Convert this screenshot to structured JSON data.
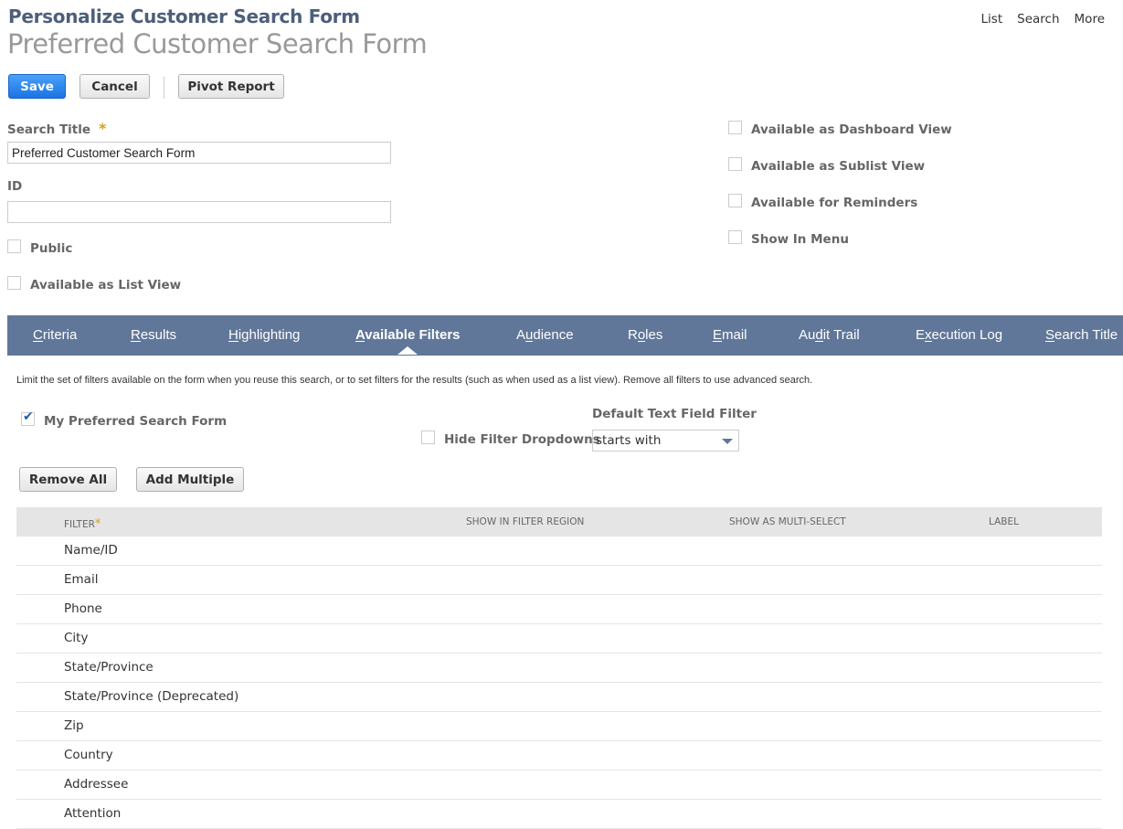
{
  "header": {
    "subtitle": "Personalize Customer Search Form",
    "title": "Preferred Customer Search Form",
    "links": [
      "List",
      "Search",
      "More"
    ]
  },
  "toolbar": {
    "save": "Save",
    "cancel": "Cancel",
    "pivot": "Pivot Report"
  },
  "form": {
    "search_title_label": "Search Title",
    "required_mark": "*",
    "search_title_value": "Preferred Customer Search Form",
    "id_label": "ID",
    "id_value": "",
    "public": {
      "label": "Public",
      "checked": false
    },
    "list_view": {
      "label": "Available as List View",
      "checked": false
    },
    "dashboard_view": {
      "label": "Available as Dashboard View",
      "checked": false
    },
    "sublist_view": {
      "label": "Available as Sublist View",
      "checked": false
    },
    "reminders": {
      "label": "Available for Reminders",
      "checked": false
    },
    "show_in_menu": {
      "label": "Show In Menu",
      "checked": false
    }
  },
  "tabs": [
    {
      "label": "Criteria",
      "key_index": 0
    },
    {
      "label": "Results",
      "key_index": 0
    },
    {
      "label": "Highlighting",
      "key_index": 0
    },
    {
      "label": "Available Filters",
      "key_index": 0,
      "active": true
    },
    {
      "label": "Audience",
      "key_index": 1
    },
    {
      "label": "Roles",
      "key_index": 1
    },
    {
      "label": "Email",
      "key_index": 0
    },
    {
      "label": "Audit Trail",
      "key_index": 2
    },
    {
      "label": "Execution Log",
      "key_index": 1
    },
    {
      "label": "Search Title",
      "key_index": 0
    }
  ],
  "filters": {
    "description": "Limit the set of filters available on the form when you reuse this search, or to set filters for the results (such as when used as a list view). Remove all filters to use advanced search.",
    "preferred": {
      "label": "My Preferred Search Form",
      "checked": true
    },
    "hide_dropdowns": {
      "label": "Hide Filter Dropdowns",
      "checked": false
    },
    "default_filter_label": "Default Text Field Filter",
    "default_filter_value": "starts with",
    "remove_all": "Remove All",
    "add_multiple": "Add Multiple",
    "columns": [
      "FILTER",
      "SHOW IN FILTER REGION",
      "SHOW AS MULTI-SELECT",
      "LABEL"
    ],
    "rows": [
      "Name/ID",
      "Email",
      "Phone",
      "City",
      "State/Province",
      "State/Province (Deprecated)",
      "Zip",
      "Country",
      "Addressee",
      "Attention"
    ]
  },
  "colors": {
    "tab_bar": "#607799",
    "primary": "#1a74e4",
    "required": "#d5a21b"
  }
}
